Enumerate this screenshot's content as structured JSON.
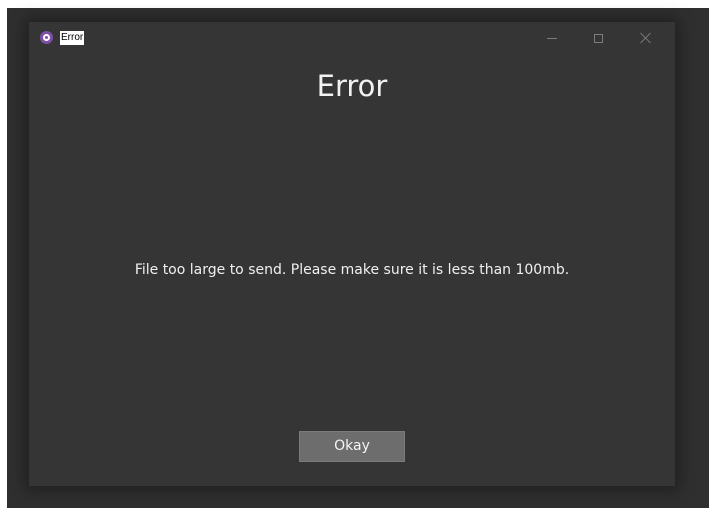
{
  "window": {
    "title": "Error",
    "controls": {
      "minimize_icon": "minimize-icon",
      "maximize_icon": "maximize-icon",
      "close_icon": "close-icon"
    }
  },
  "dialog": {
    "heading": "Error",
    "message": "File too large to send. Please make sure it is less than 100mb.",
    "okay_label": "Okay"
  },
  "colors": {
    "window_bg": "#353535",
    "button_bg": "#6d6d6d",
    "app_icon": "#7d4fa8",
    "text": "#f0f0f0"
  }
}
